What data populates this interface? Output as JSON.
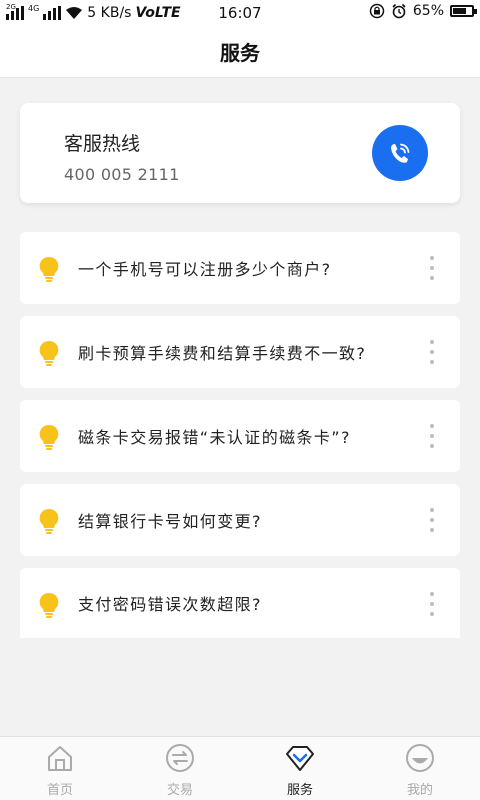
{
  "status_bar": {
    "network_small": "2G",
    "network_type": "4G",
    "speed": "5 KB/s",
    "volte": "VoLTE",
    "time": "16:07",
    "battery": "65%",
    "battery_level": 0.65
  },
  "header": {
    "title": "服务"
  },
  "hotline": {
    "title": "客服热线",
    "number": "400 005 2111",
    "accent": "#1a6ef0"
  },
  "faq": [
    {
      "text": "一个手机号可以注册多少个商户?"
    },
    {
      "text": "刷卡预算手续费和结算手续费不一致?"
    },
    {
      "text": "磁条卡交易报错“未认证的磁条卡”?"
    },
    {
      "text": "结算银行卡号如何变更?"
    },
    {
      "text": "支付密码错误次数超限?"
    }
  ],
  "bottom_nav": {
    "home": "首页",
    "trade": "交易",
    "service": "服务",
    "mine": "我的"
  },
  "icons": {
    "faq": "lightbulb-icon",
    "call": "phone-icon",
    "more": "more-vertical-icon"
  },
  "colors": {
    "bulb": "#f7c21a",
    "active_tab": "#222222",
    "inactive_tab": "#aaaaaa"
  }
}
